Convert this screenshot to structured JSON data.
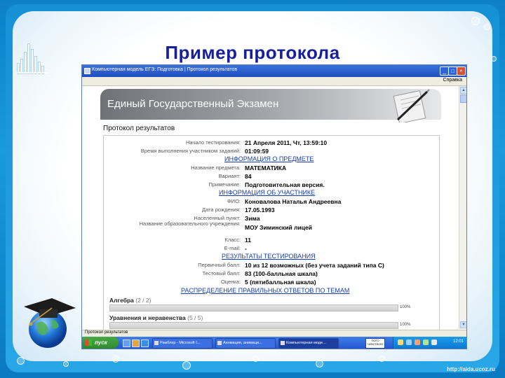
{
  "slide": {
    "title": "Пример протокола",
    "site_url": "http://aida.ucoz.ru"
  },
  "window": {
    "title": "Компьютерная модель ЕГЭ: Подготовка | Протокол результатов",
    "menu_help": "Справка",
    "status_text": "Протокол результатов"
  },
  "banner": {
    "title": "Единый Государственный Экзамен"
  },
  "protocol": {
    "heading": "Протокол результатов",
    "rows": [
      {
        "label": "Начало тестирования:",
        "value": "21 Апреля 2011, Чт, 13:59:10"
      },
      {
        "label": "Время выполнения участником заданий:",
        "value": "01:09:59"
      },
      {
        "section": "ИНФОРМАЦИЯ О ПРЕДМЕТЕ"
      },
      {
        "label": "Название предмета:",
        "value": "МАТЕМАТИКА"
      },
      {
        "label": "Вариант:",
        "value": "84"
      },
      {
        "label": "Примечание:",
        "value": "Подготовительная версия."
      },
      {
        "section": "ИНФОРМАЦИЯ ОБ УЧАСТНИКЕ"
      },
      {
        "label": "ФИО:",
        "value": "Коновалова Наталья Андреевна"
      },
      {
        "label": "Дата рождения:",
        "value": "17.05.1993"
      },
      {
        "label": "Населенный пункт:",
        "value": "Зима"
      },
      {
        "label": "Название образовательного учреждения:",
        "value": "МОУ Зиминский лицей"
      },
      {
        "label": "Класс:",
        "value": "11"
      },
      {
        "label": "E-mail:",
        "value": "-"
      },
      {
        "section": "РЕЗУЛЬТАТЫ ТЕСТИРОВАНИЯ"
      },
      {
        "label": "Первичный балл:",
        "value": "10 из 12 возможных (без учета заданий типа С)"
      },
      {
        "label": "Тестовый балл:",
        "value": "83 (100-балльная шкала)"
      },
      {
        "label": "Оценка:",
        "value": "5 (пятибалльная шкала)"
      }
    ],
    "distribution_heading": "РАСПРЕДЕЛЕНИЕ ПРАВИЛЬНЫХ ОТВЕТОВ ПО ТЕМАМ",
    "topics": [
      {
        "name": "Алгебра",
        "count": "(2 / 2)",
        "percent": 100,
        "percent_label": "100%"
      },
      {
        "name": "Уравнения и неравенства",
        "count": "(5 / 5)",
        "percent": 100,
        "percent_label": "100%"
      }
    ]
  },
  "taskbar": {
    "start": "пуск",
    "tasks": [
      "Рамблер - Microsoft I...",
      "Аннмация, анимаци...",
      "Компьютерная моде..."
    ],
    "lang": "ПОГО ЧУВСТВУЮ",
    "clock": "12:01"
  }
}
